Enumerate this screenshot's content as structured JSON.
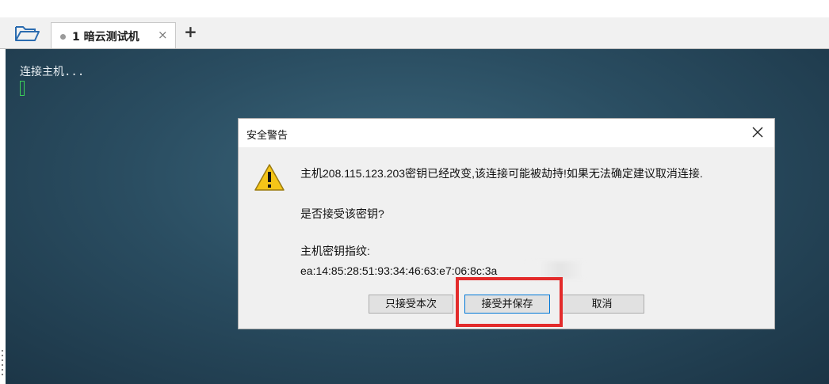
{
  "toolbar": {
    "folder_icon": "folder-open-icon",
    "tab": {
      "label": "1 暗云测试机",
      "close_glyph": "×",
      "status_icon": "dot-icon"
    },
    "add_tab_glyph": "+"
  },
  "terminal": {
    "line1": "连接主机...",
    "cursor_color": "#3cd15a"
  },
  "dialog": {
    "title": "安全警告",
    "close_glyph": "×",
    "icon": "warning-icon",
    "message_line1": "主机208.115.123.203密钥已经改变,该连接可能被劫持!如果无法确定建议取消连接.",
    "message_line2": "是否接受该密钥?",
    "fingerprint_label": "主机密钥指纹:",
    "fingerprint_value": "ea:14:85:28:51:93:34:46:63:e7:06:8c:3a",
    "buttons": {
      "accept_once": "只接受本次",
      "accept_save": "接受并保存",
      "cancel": "取消"
    }
  },
  "colors": {
    "highlight": "#e32b2b",
    "warning_yellow": "#f5c518"
  }
}
